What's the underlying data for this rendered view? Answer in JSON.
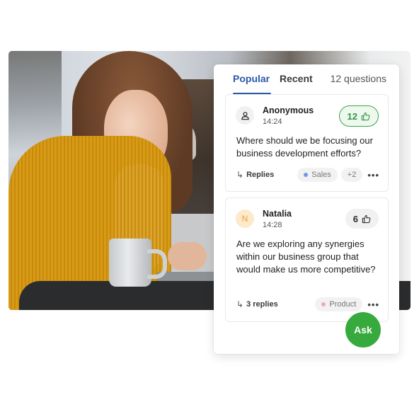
{
  "tabs": [
    {
      "label": "Popular",
      "active": true
    },
    {
      "label": "Recent",
      "active": false
    }
  ],
  "question_count": "12 questions",
  "questions": [
    {
      "author": "Anonymous",
      "avatar": "user-icon",
      "time": "14:24",
      "votes": "12",
      "voted": true,
      "text": "Where should we be focusing our business development efforts?",
      "replies_label": "Replies",
      "tags": [
        {
          "label": "Sales",
          "color": "#6b9be6"
        }
      ],
      "extra_tags": "+2"
    },
    {
      "author": "Natalia",
      "avatar": "N",
      "time": "14:28",
      "votes": "6",
      "voted": false,
      "text": "Are we exploring any synergies within our business group that would make us more competitive?",
      "replies_label": "3 replies",
      "tags": [
        {
          "label": "Product",
          "color": "#f0a6c8"
        }
      ]
    }
  ],
  "more_label": "•••",
  "reply_arrow": "↳",
  "ask_label": "Ask",
  "colors": {
    "accent": "#2c5aa7",
    "green": "#37aa3e"
  }
}
